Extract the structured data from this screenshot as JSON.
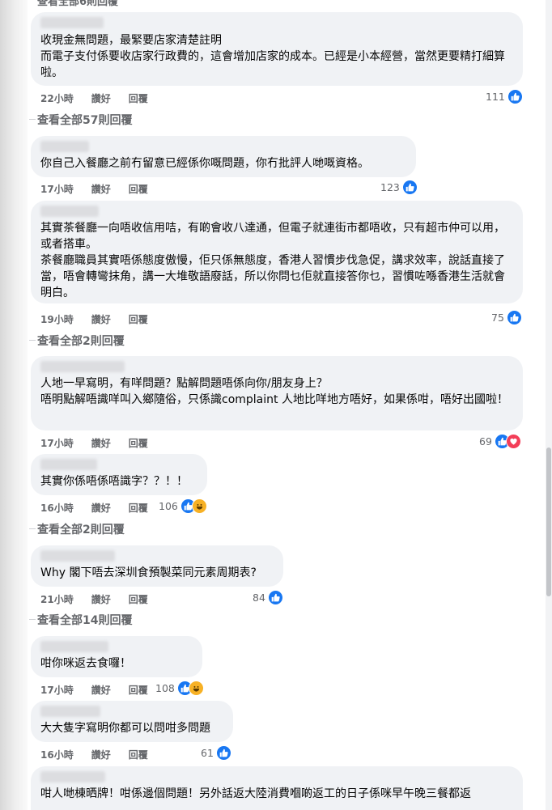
{
  "top_cut": "查看全部6則回覆",
  "actions": {
    "like": "讚好",
    "reply": "回覆"
  },
  "view_replies": [
    {
      "text": "查看全部57則回覆"
    },
    {
      "text": "查看全部2則回覆"
    },
    {
      "text": "查看全部2則回覆"
    },
    {
      "text": "查看全部14則回覆"
    }
  ],
  "comments": [
    {
      "text": "收現金無問題，最緊要店家清楚註明\n而電子支付係要收店家行政費的，這會增加店家的成本。已經是小本經營，當然更要精打細算啦。",
      "time": "22小時",
      "count": "111",
      "reactions": [
        "like"
      ]
    },
    {
      "text": "你自己入餐廳之前冇留意已經係你嘅問題，你冇批評人哋嘅資格。",
      "time": "17小時",
      "count": "123",
      "reactions": [
        "like"
      ]
    },
    {
      "text": "其實茶餐廳一向唔收信用咭，有啲會收八達通，但電子就連街市都唔收，只有超市仲可以用，或者搭車。\n茶餐廳職員其實唔係態度傲慢，佢只係無態度，香港人習慣步伐急促，講求效率，說話直接了當，唔會轉彎抹角，講一大堆敬語廢話，所以你問乜佢就直接答你乜，習慣咗喺香港生活就會明白。",
      "time": "19小時",
      "count": "75",
      "reactions": [
        "like"
      ]
    },
    {
      "text": "人地一早寫明，有咩問題？點解問題唔係向你/朋友身上？\n唔明點解唔識咩叫入鄉隨俗，只係識complaint 人地比咩地方唔好，如果係咁，唔好出國啦！",
      "time": "17小時",
      "count": "69",
      "reactions": [
        "like",
        "love"
      ]
    },
    {
      "text": "其實你係唔係唔識字？？！！",
      "time": "16小時",
      "count": "106",
      "reactions": [
        "like",
        "haha"
      ]
    },
    {
      "text": "Why 閣下唔去深圳食預製菜同元素周期表?",
      "time": "21小時",
      "count": "84",
      "reactions": [
        "like"
      ]
    },
    {
      "text": "咁你咪返去食囉！",
      "time": "17小時",
      "count": "108",
      "reactions": [
        "like",
        "haha"
      ]
    },
    {
      "text": "大大隻字寫明你都可以問咁多問題",
      "time": "16小時",
      "count": "61",
      "reactions": [
        "like"
      ]
    },
    {
      "text": "咁人哋棟晒牌！咁係邊個問題！另外話返大陸消費嗰啲返工的日子係咪早午晚三餐都返",
      "time": "",
      "count": "",
      "reactions": []
    }
  ]
}
